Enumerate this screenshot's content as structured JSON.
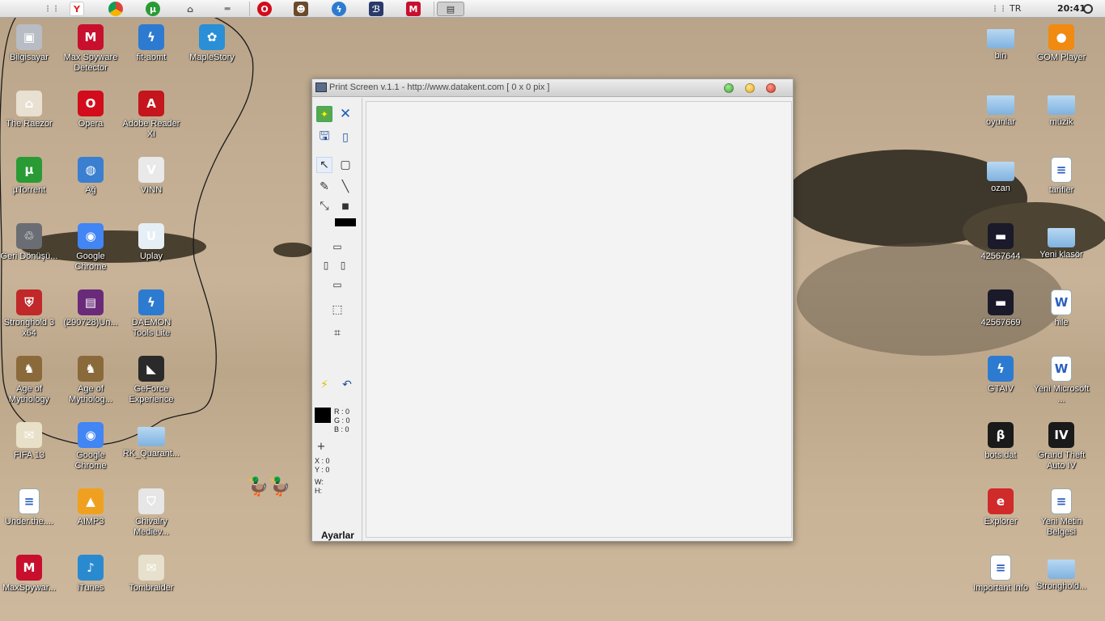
{
  "topbar": {
    "language": "TR",
    "clock": "20:41"
  },
  "desktop_left": [
    {
      "label": "Bilgisayar",
      "icon": "computer-icon"
    },
    {
      "label": "Max Spyware Detector",
      "icon": "mcafee-icon"
    },
    {
      "label": "fit-aomt",
      "icon": "daemon-tools-icon"
    },
    {
      "label": "MapleStory",
      "icon": "maplestory-icon"
    },
    {
      "label": "The Raezor",
      "icon": "house-icon"
    },
    {
      "label": "Opera",
      "icon": "opera-icon"
    },
    {
      "label": "Adobe Reader XI",
      "icon": "adobe-reader-icon"
    },
    {
      "label": "µTorrent",
      "icon": "utorrent-icon"
    },
    {
      "label": "Ağ",
      "icon": "network-globe-icon"
    },
    {
      "label": "VINN",
      "icon": "vinn-icon"
    },
    {
      "label": "Geri Dönüşü...",
      "icon": "recycle-bin-icon"
    },
    {
      "label": "Google Chrome",
      "icon": "chrome-icon"
    },
    {
      "label": "Uplay",
      "icon": "uplay-icon"
    },
    {
      "label": "Stronghold 3 x64",
      "icon": "stronghold-icon"
    },
    {
      "label": "(290728)Un...",
      "icon": "winrar-icon"
    },
    {
      "label": "DAEMON Tools Lite",
      "icon": "daemon-tools-icon"
    },
    {
      "label": "Age of Mythology",
      "icon": "age-of-mythology-icon"
    },
    {
      "label": "Age of Mytholog...",
      "icon": "age-of-mythology-icon"
    },
    {
      "label": "GeForce Experience",
      "icon": "geforce-icon"
    },
    {
      "label": "FIFA 13",
      "icon": "fifa-icon"
    },
    {
      "label": "Google Chrome",
      "icon": "chrome-icon"
    },
    {
      "label": "RK_Quarant...",
      "icon": "folder-icon"
    },
    {
      "label": "Under.the....",
      "icon": "document-icon"
    },
    {
      "label": "AIMP3",
      "icon": "aimp-icon"
    },
    {
      "label": "Chivalry Mediev...",
      "icon": "chivalry-icon"
    },
    {
      "label": "MaxSpywar...",
      "icon": "mcafee-icon"
    },
    {
      "label": "iTunes",
      "icon": "itunes-icon"
    },
    {
      "label": "Tombraider",
      "icon": "tombraider-icon"
    }
  ],
  "desktop_right": [
    {
      "label": "bin",
      "icon": "folder-icon"
    },
    {
      "label": "GOM Player",
      "icon": "gom-player-icon"
    },
    {
      "label": "oyunlar",
      "icon": "folder-icon"
    },
    {
      "label": "müzik",
      "icon": "folder-icon"
    },
    {
      "label": "ozan",
      "icon": "folder-icon"
    },
    {
      "label": "tarifler",
      "icon": "document-icon"
    },
    {
      "label": "42567644",
      "icon": "image-icon"
    },
    {
      "label": "Yeni klasör",
      "icon": "folder-icon"
    },
    {
      "label": "42567669",
      "icon": "image-icon"
    },
    {
      "label": "hile",
      "icon": "word-document-icon"
    },
    {
      "label": "GTAIV",
      "icon": "daemon-tools-icon"
    },
    {
      "label": "Yeni Microsoft ...",
      "icon": "word-document-icon"
    },
    {
      "label": "bots.dat",
      "icon": "bots-icon"
    },
    {
      "label": "Grand Theft Auto IV",
      "icon": "gta-iv-icon"
    },
    {
      "label": "Explorer",
      "icon": "explorer-icon"
    },
    {
      "label": "Yeni Metin Belgesi",
      "icon": "document-icon"
    },
    {
      "label": "Important Info",
      "icon": "document-icon"
    },
    {
      "label": "Stronghold...",
      "icon": "folder-icon"
    }
  ],
  "window": {
    "title": "Print Screen v.1.1 - http://www.datakent.com  [ 0 x 0 pix ]",
    "color_readout": {
      "r": "R : 0",
      "g": "G : 0",
      "b": "B : 0"
    },
    "coords": {
      "x": "X : 0",
      "y": "Y : 0",
      "w": "W:",
      "h": "H:"
    },
    "settings_label": "Ayarlar"
  }
}
